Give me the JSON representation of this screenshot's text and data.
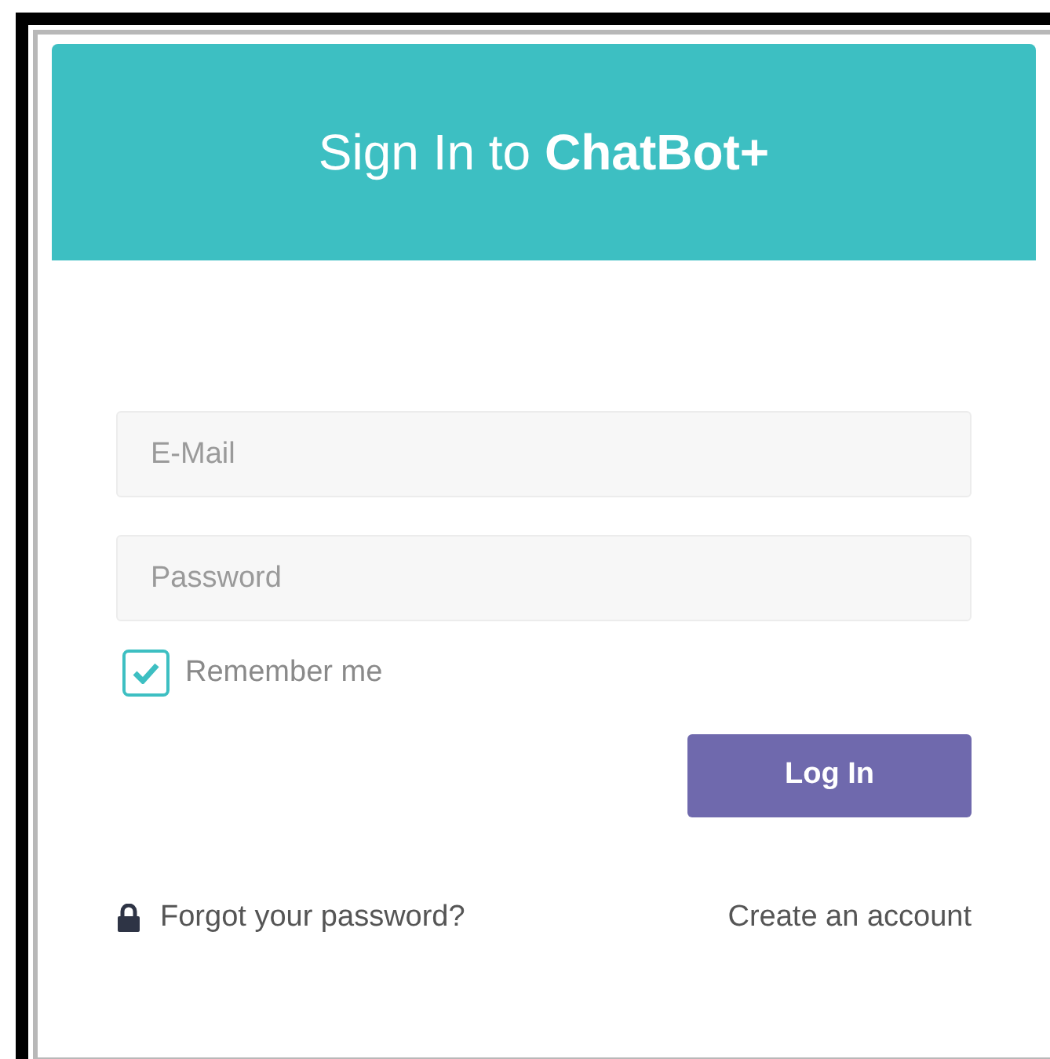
{
  "header": {
    "title": "Sign In to **ChatBot+**"
  },
  "fields": [
    {
      "placeholder": "E-Mail"
    },
    {
      "placeholder": "Password"
    }
  ],
  "remember": {
    "label": "Remember me",
    "checked": true
  },
  "login_button": "Log In",
  "links": {
    "forgot": "Forgot your password?",
    "create": "Create an account"
  }
}
